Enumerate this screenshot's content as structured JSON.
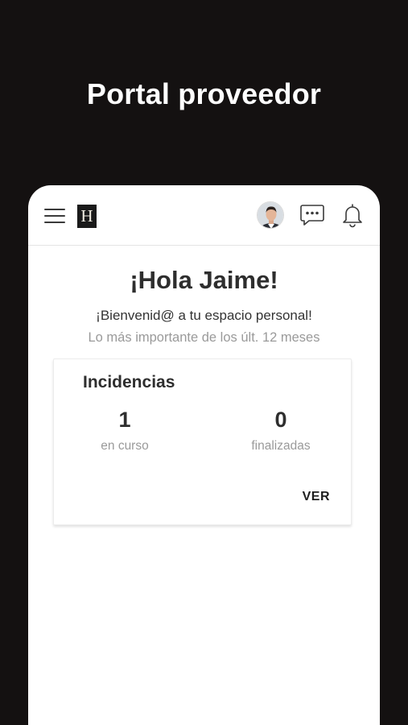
{
  "promo": {
    "title": "Portal proveedor"
  },
  "header": {
    "logo_letter": "H",
    "icons": {
      "menu": "hamburger-menu-icon",
      "avatar": "user-avatar",
      "chat": "chat-bubble-icon",
      "notifications": "bell-icon"
    }
  },
  "main": {
    "greeting": "¡Hola Jaime!",
    "welcome": "¡Bienvenid@ a tu espacio personal!",
    "period": "Lo más importante de los últ. 12 meses"
  },
  "card": {
    "title": "Incidencias",
    "stats": [
      {
        "value": "1",
        "label": "en curso"
      },
      {
        "value": "0",
        "label": "finalizadas"
      }
    ],
    "action_label": "VER"
  },
  "colors": {
    "background": "#141111",
    "surface": "#ffffff",
    "text_primary": "#2e2e2e",
    "text_secondary": "#9a9a9a"
  }
}
